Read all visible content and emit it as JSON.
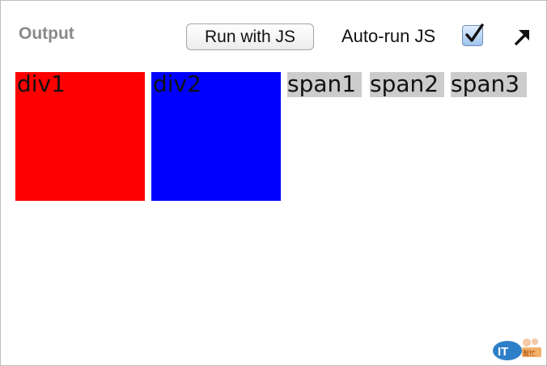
{
  "toolbar": {
    "output_label": "Output",
    "run_label": "Run with JS",
    "autorun_label": "Auto-run JS",
    "autorun_checked": true,
    "expand_icon": "expand-arrow-icon"
  },
  "output": {
    "divs": [
      {
        "label": "div1",
        "color": "#ff0000"
      },
      {
        "label": "div2",
        "color": "#0000ff"
      }
    ],
    "spans": [
      {
        "label": "span1"
      },
      {
        "label": "span2"
      },
      {
        "label": "span3"
      }
    ],
    "span_background": "#cccccc"
  },
  "watermark": {
    "brand": "IT邦幫忙"
  }
}
